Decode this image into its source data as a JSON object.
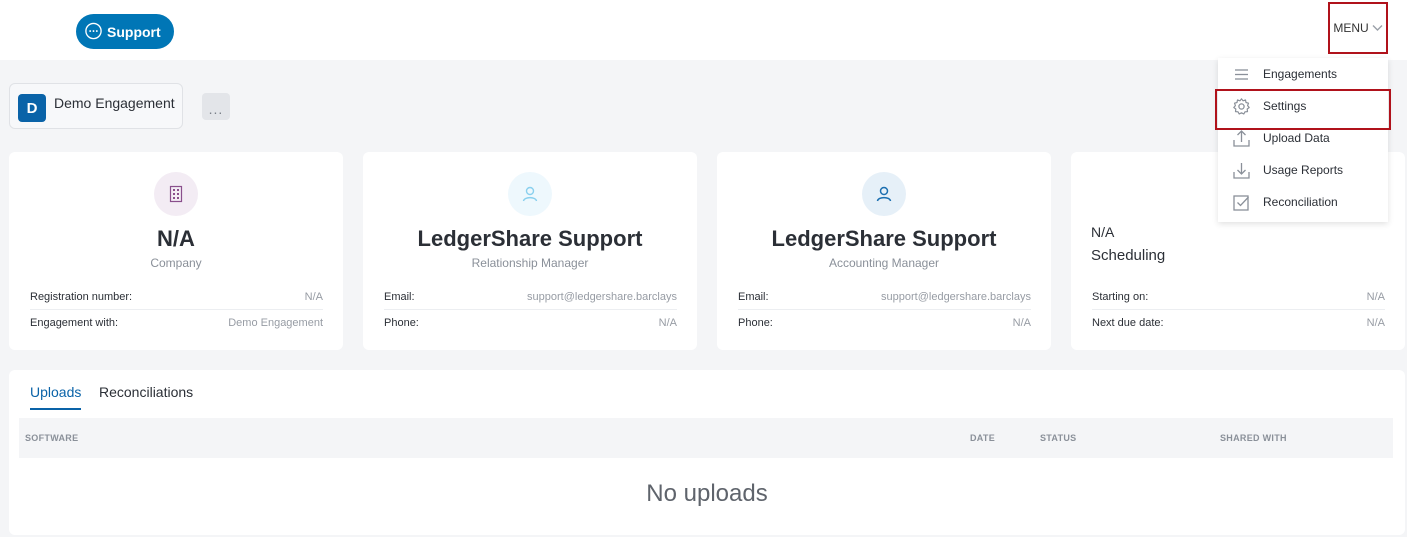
{
  "header": {
    "support_label": "Support",
    "menu_label": "MENU"
  },
  "engagement": {
    "avatar_letter": "D",
    "name": "Demo Engagement",
    "more_label": "..."
  },
  "menu": {
    "items": [
      {
        "label": "Engagements",
        "icon": "list-icon"
      },
      {
        "label": "Settings",
        "icon": "gear-icon"
      },
      {
        "label": "Upload Data",
        "icon": "upload-icon"
      },
      {
        "label": "Usage Reports",
        "icon": "download-icon"
      },
      {
        "label": "Reconciliation",
        "icon": "checkbox-icon"
      }
    ],
    "highlighted": "Settings"
  },
  "cards": [
    {
      "icon": "building-icon",
      "title": "N/A",
      "subtitle": "Company",
      "rows": [
        {
          "key": "Registration number:",
          "value": "N/A"
        },
        {
          "key": "Engagement with:",
          "value": "Demo Engagement"
        }
      ]
    },
    {
      "icon": "user-icon",
      "title": "LedgerShare Support",
      "subtitle": "Relationship Manager",
      "rows": [
        {
          "key": "Email:",
          "value": "support@ledgershare.barclays"
        },
        {
          "key": "Phone:",
          "value": "N/A"
        }
      ]
    },
    {
      "icon": "user-icon",
      "title": "LedgerShare Support",
      "subtitle": "Accounting Manager",
      "rows": [
        {
          "key": "Email:",
          "value": "support@ledgershare.barclays"
        },
        {
          "key": "Phone:",
          "value": "N/A"
        }
      ]
    },
    {
      "line1": "N/A",
      "line2": "Scheduling",
      "rows": [
        {
          "key": "Starting on:",
          "value": "N/A"
        },
        {
          "key": "Next due date:",
          "value": "N/A"
        }
      ]
    }
  ],
  "tabs": [
    {
      "label": "Uploads",
      "active": true
    },
    {
      "label": "Reconciliations",
      "active": false
    }
  ],
  "table": {
    "columns": [
      "SOFTWARE",
      "DATE",
      "STATUS",
      "SHARED WITH"
    ],
    "empty_message": "No uploads"
  },
  "colors": {
    "brand": "#0076b6",
    "highlight_border": "#b0121b"
  }
}
